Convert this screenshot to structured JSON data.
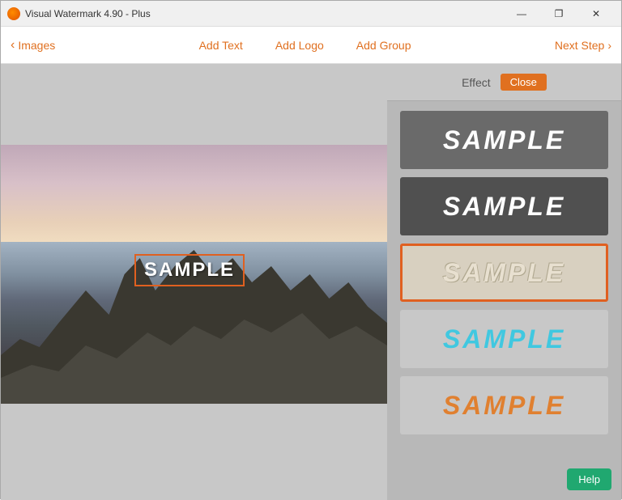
{
  "titlebar": {
    "title": "Visual Watermark 4.90 - Plus",
    "min_btn": "—",
    "max_btn": "❐",
    "close_btn": "✕"
  },
  "toolbar": {
    "back_label": "Images",
    "add_text_label": "Add Text",
    "add_logo_label": "Add Logo",
    "add_group_label": "Add Group",
    "next_step_label": "Next Step"
  },
  "effects_panel": {
    "effect_label": "Effect",
    "close_label": "Close",
    "sample_text": "SAMPLE"
  },
  "watermark": {
    "sample_text": "SAMPLE"
  },
  "help_btn": "Help"
}
